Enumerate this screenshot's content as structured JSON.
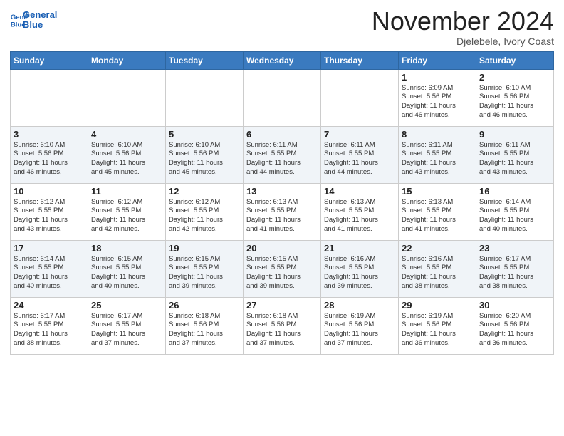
{
  "logo": {
    "text_general": "General",
    "text_blue": "Blue"
  },
  "header": {
    "month_title": "November 2024",
    "subtitle": "Djelebele, Ivory Coast"
  },
  "weekdays": [
    "Sunday",
    "Monday",
    "Tuesday",
    "Wednesday",
    "Thursday",
    "Friday",
    "Saturday"
  ],
  "weeks": [
    [
      {
        "day": "",
        "info": ""
      },
      {
        "day": "",
        "info": ""
      },
      {
        "day": "",
        "info": ""
      },
      {
        "day": "",
        "info": ""
      },
      {
        "day": "",
        "info": ""
      },
      {
        "day": "1",
        "info": "Sunrise: 6:09 AM\nSunset: 5:56 PM\nDaylight: 11 hours\nand 46 minutes."
      },
      {
        "day": "2",
        "info": "Sunrise: 6:10 AM\nSunset: 5:56 PM\nDaylight: 11 hours\nand 46 minutes."
      }
    ],
    [
      {
        "day": "3",
        "info": "Sunrise: 6:10 AM\nSunset: 5:56 PM\nDaylight: 11 hours\nand 46 minutes."
      },
      {
        "day": "4",
        "info": "Sunrise: 6:10 AM\nSunset: 5:56 PM\nDaylight: 11 hours\nand 45 minutes."
      },
      {
        "day": "5",
        "info": "Sunrise: 6:10 AM\nSunset: 5:56 PM\nDaylight: 11 hours\nand 45 minutes."
      },
      {
        "day": "6",
        "info": "Sunrise: 6:11 AM\nSunset: 5:55 PM\nDaylight: 11 hours\nand 44 minutes."
      },
      {
        "day": "7",
        "info": "Sunrise: 6:11 AM\nSunset: 5:55 PM\nDaylight: 11 hours\nand 44 minutes."
      },
      {
        "day": "8",
        "info": "Sunrise: 6:11 AM\nSunset: 5:55 PM\nDaylight: 11 hours\nand 43 minutes."
      },
      {
        "day": "9",
        "info": "Sunrise: 6:11 AM\nSunset: 5:55 PM\nDaylight: 11 hours\nand 43 minutes."
      }
    ],
    [
      {
        "day": "10",
        "info": "Sunrise: 6:12 AM\nSunset: 5:55 PM\nDaylight: 11 hours\nand 43 minutes."
      },
      {
        "day": "11",
        "info": "Sunrise: 6:12 AM\nSunset: 5:55 PM\nDaylight: 11 hours\nand 42 minutes."
      },
      {
        "day": "12",
        "info": "Sunrise: 6:12 AM\nSunset: 5:55 PM\nDaylight: 11 hours\nand 42 minutes."
      },
      {
        "day": "13",
        "info": "Sunrise: 6:13 AM\nSunset: 5:55 PM\nDaylight: 11 hours\nand 41 minutes."
      },
      {
        "day": "14",
        "info": "Sunrise: 6:13 AM\nSunset: 5:55 PM\nDaylight: 11 hours\nand 41 minutes."
      },
      {
        "day": "15",
        "info": "Sunrise: 6:13 AM\nSunset: 5:55 PM\nDaylight: 11 hours\nand 41 minutes."
      },
      {
        "day": "16",
        "info": "Sunrise: 6:14 AM\nSunset: 5:55 PM\nDaylight: 11 hours\nand 40 minutes."
      }
    ],
    [
      {
        "day": "17",
        "info": "Sunrise: 6:14 AM\nSunset: 5:55 PM\nDaylight: 11 hours\nand 40 minutes."
      },
      {
        "day": "18",
        "info": "Sunrise: 6:15 AM\nSunset: 5:55 PM\nDaylight: 11 hours\nand 40 minutes."
      },
      {
        "day": "19",
        "info": "Sunrise: 6:15 AM\nSunset: 5:55 PM\nDaylight: 11 hours\nand 39 minutes."
      },
      {
        "day": "20",
        "info": "Sunrise: 6:15 AM\nSunset: 5:55 PM\nDaylight: 11 hours\nand 39 minutes."
      },
      {
        "day": "21",
        "info": "Sunrise: 6:16 AM\nSunset: 5:55 PM\nDaylight: 11 hours\nand 39 minutes."
      },
      {
        "day": "22",
        "info": "Sunrise: 6:16 AM\nSunset: 5:55 PM\nDaylight: 11 hours\nand 38 minutes."
      },
      {
        "day": "23",
        "info": "Sunrise: 6:17 AM\nSunset: 5:55 PM\nDaylight: 11 hours\nand 38 minutes."
      }
    ],
    [
      {
        "day": "24",
        "info": "Sunrise: 6:17 AM\nSunset: 5:55 PM\nDaylight: 11 hours\nand 38 minutes."
      },
      {
        "day": "25",
        "info": "Sunrise: 6:17 AM\nSunset: 5:55 PM\nDaylight: 11 hours\nand 37 minutes."
      },
      {
        "day": "26",
        "info": "Sunrise: 6:18 AM\nSunset: 5:56 PM\nDaylight: 11 hours\nand 37 minutes."
      },
      {
        "day": "27",
        "info": "Sunrise: 6:18 AM\nSunset: 5:56 PM\nDaylight: 11 hours\nand 37 minutes."
      },
      {
        "day": "28",
        "info": "Sunrise: 6:19 AM\nSunset: 5:56 PM\nDaylight: 11 hours\nand 37 minutes."
      },
      {
        "day": "29",
        "info": "Sunrise: 6:19 AM\nSunset: 5:56 PM\nDaylight: 11 hours\nand 36 minutes."
      },
      {
        "day": "30",
        "info": "Sunrise: 6:20 AM\nSunset: 5:56 PM\nDaylight: 11 hours\nand 36 minutes."
      }
    ]
  ]
}
